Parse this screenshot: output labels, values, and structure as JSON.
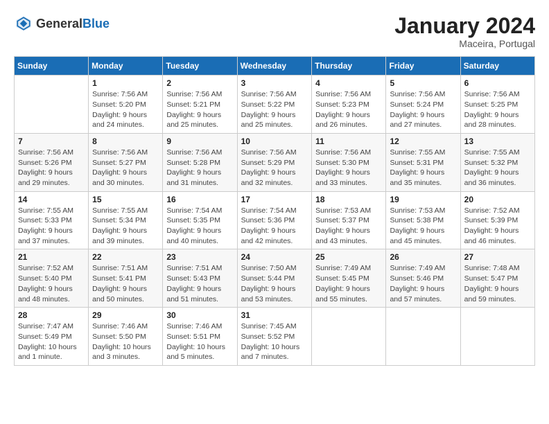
{
  "logo": {
    "general": "General",
    "blue": "Blue"
  },
  "title": "January 2024",
  "location": "Maceira, Portugal",
  "days_header": [
    "Sunday",
    "Monday",
    "Tuesday",
    "Wednesday",
    "Thursday",
    "Friday",
    "Saturday"
  ],
  "weeks": [
    [
      {
        "day": "",
        "sunrise": "",
        "sunset": "",
        "daylight": ""
      },
      {
        "day": "1",
        "sunrise": "Sunrise: 7:56 AM",
        "sunset": "Sunset: 5:20 PM",
        "daylight": "Daylight: 9 hours and 24 minutes."
      },
      {
        "day": "2",
        "sunrise": "Sunrise: 7:56 AM",
        "sunset": "Sunset: 5:21 PM",
        "daylight": "Daylight: 9 hours and 25 minutes."
      },
      {
        "day": "3",
        "sunrise": "Sunrise: 7:56 AM",
        "sunset": "Sunset: 5:22 PM",
        "daylight": "Daylight: 9 hours and 25 minutes."
      },
      {
        "day": "4",
        "sunrise": "Sunrise: 7:56 AM",
        "sunset": "Sunset: 5:23 PM",
        "daylight": "Daylight: 9 hours and 26 minutes."
      },
      {
        "day": "5",
        "sunrise": "Sunrise: 7:56 AM",
        "sunset": "Sunset: 5:24 PM",
        "daylight": "Daylight: 9 hours and 27 minutes."
      },
      {
        "day": "6",
        "sunrise": "Sunrise: 7:56 AM",
        "sunset": "Sunset: 5:25 PM",
        "daylight": "Daylight: 9 hours and 28 minutes."
      }
    ],
    [
      {
        "day": "7",
        "sunrise": "Sunrise: 7:56 AM",
        "sunset": "Sunset: 5:26 PM",
        "daylight": "Daylight: 9 hours and 29 minutes."
      },
      {
        "day": "8",
        "sunrise": "Sunrise: 7:56 AM",
        "sunset": "Sunset: 5:27 PM",
        "daylight": "Daylight: 9 hours and 30 minutes."
      },
      {
        "day": "9",
        "sunrise": "Sunrise: 7:56 AM",
        "sunset": "Sunset: 5:28 PM",
        "daylight": "Daylight: 9 hours and 31 minutes."
      },
      {
        "day": "10",
        "sunrise": "Sunrise: 7:56 AM",
        "sunset": "Sunset: 5:29 PM",
        "daylight": "Daylight: 9 hours and 32 minutes."
      },
      {
        "day": "11",
        "sunrise": "Sunrise: 7:56 AM",
        "sunset": "Sunset: 5:30 PM",
        "daylight": "Daylight: 9 hours and 33 minutes."
      },
      {
        "day": "12",
        "sunrise": "Sunrise: 7:55 AM",
        "sunset": "Sunset: 5:31 PM",
        "daylight": "Daylight: 9 hours and 35 minutes."
      },
      {
        "day": "13",
        "sunrise": "Sunrise: 7:55 AM",
        "sunset": "Sunset: 5:32 PM",
        "daylight": "Daylight: 9 hours and 36 minutes."
      }
    ],
    [
      {
        "day": "14",
        "sunrise": "Sunrise: 7:55 AM",
        "sunset": "Sunset: 5:33 PM",
        "daylight": "Daylight: 9 hours and 37 minutes."
      },
      {
        "day": "15",
        "sunrise": "Sunrise: 7:55 AM",
        "sunset": "Sunset: 5:34 PM",
        "daylight": "Daylight: 9 hours and 39 minutes."
      },
      {
        "day": "16",
        "sunrise": "Sunrise: 7:54 AM",
        "sunset": "Sunset: 5:35 PM",
        "daylight": "Daylight: 9 hours and 40 minutes."
      },
      {
        "day": "17",
        "sunrise": "Sunrise: 7:54 AM",
        "sunset": "Sunset: 5:36 PM",
        "daylight": "Daylight: 9 hours and 42 minutes."
      },
      {
        "day": "18",
        "sunrise": "Sunrise: 7:53 AM",
        "sunset": "Sunset: 5:37 PM",
        "daylight": "Daylight: 9 hours and 43 minutes."
      },
      {
        "day": "19",
        "sunrise": "Sunrise: 7:53 AM",
        "sunset": "Sunset: 5:38 PM",
        "daylight": "Daylight: 9 hours and 45 minutes."
      },
      {
        "day": "20",
        "sunrise": "Sunrise: 7:52 AM",
        "sunset": "Sunset: 5:39 PM",
        "daylight": "Daylight: 9 hours and 46 minutes."
      }
    ],
    [
      {
        "day": "21",
        "sunrise": "Sunrise: 7:52 AM",
        "sunset": "Sunset: 5:40 PM",
        "daylight": "Daylight: 9 hours and 48 minutes."
      },
      {
        "day": "22",
        "sunrise": "Sunrise: 7:51 AM",
        "sunset": "Sunset: 5:41 PM",
        "daylight": "Daylight: 9 hours and 50 minutes."
      },
      {
        "day": "23",
        "sunrise": "Sunrise: 7:51 AM",
        "sunset": "Sunset: 5:43 PM",
        "daylight": "Daylight: 9 hours and 51 minutes."
      },
      {
        "day": "24",
        "sunrise": "Sunrise: 7:50 AM",
        "sunset": "Sunset: 5:44 PM",
        "daylight": "Daylight: 9 hours and 53 minutes."
      },
      {
        "day": "25",
        "sunrise": "Sunrise: 7:49 AM",
        "sunset": "Sunset: 5:45 PM",
        "daylight": "Daylight: 9 hours and 55 minutes."
      },
      {
        "day": "26",
        "sunrise": "Sunrise: 7:49 AM",
        "sunset": "Sunset: 5:46 PM",
        "daylight": "Daylight: 9 hours and 57 minutes."
      },
      {
        "day": "27",
        "sunrise": "Sunrise: 7:48 AM",
        "sunset": "Sunset: 5:47 PM",
        "daylight": "Daylight: 9 hours and 59 minutes."
      }
    ],
    [
      {
        "day": "28",
        "sunrise": "Sunrise: 7:47 AM",
        "sunset": "Sunset: 5:49 PM",
        "daylight": "Daylight: 10 hours and 1 minute."
      },
      {
        "day": "29",
        "sunrise": "Sunrise: 7:46 AM",
        "sunset": "Sunset: 5:50 PM",
        "daylight": "Daylight: 10 hours and 3 minutes."
      },
      {
        "day": "30",
        "sunrise": "Sunrise: 7:46 AM",
        "sunset": "Sunset: 5:51 PM",
        "daylight": "Daylight: 10 hours and 5 minutes."
      },
      {
        "day": "31",
        "sunrise": "Sunrise: 7:45 AM",
        "sunset": "Sunset: 5:52 PM",
        "daylight": "Daylight: 10 hours and 7 minutes."
      },
      {
        "day": "",
        "sunrise": "",
        "sunset": "",
        "daylight": ""
      },
      {
        "day": "",
        "sunrise": "",
        "sunset": "",
        "daylight": ""
      },
      {
        "day": "",
        "sunrise": "",
        "sunset": "",
        "daylight": ""
      }
    ]
  ]
}
